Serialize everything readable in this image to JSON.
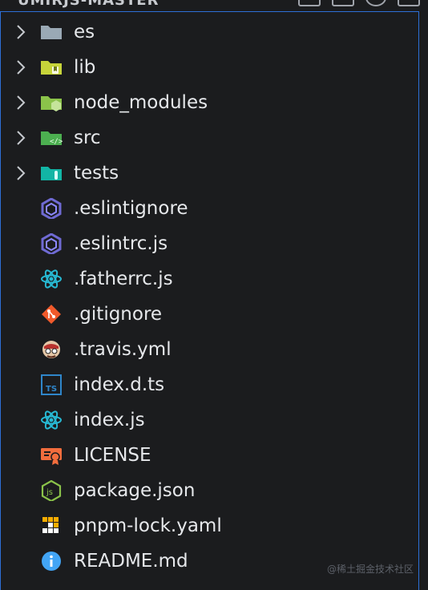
{
  "header": {
    "title": "UMIRJS-MASTER"
  },
  "tree": {
    "items": [
      {
        "label": "es",
        "type": "folder",
        "icon": "folder-icon",
        "color": "#9aa9b5"
      },
      {
        "label": "lib",
        "type": "folder",
        "icon": "folder-lib-icon",
        "color": "#c7d43a"
      },
      {
        "label": "node_modules",
        "type": "folder",
        "icon": "folder-node-icon",
        "color": "#8bc34a"
      },
      {
        "label": "src",
        "type": "folder",
        "icon": "folder-src-icon",
        "color": "#4caf50"
      },
      {
        "label": "tests",
        "type": "folder",
        "icon": "folder-test-icon",
        "color": "#12b5a5"
      },
      {
        "label": ".eslintignore",
        "type": "file",
        "icon": "eslint-icon",
        "color": "#6f6ad3"
      },
      {
        "label": ".eslintrc.js",
        "type": "file",
        "icon": "eslint-icon",
        "color": "#6f6ad3"
      },
      {
        "label": ".fatherrc.js",
        "type": "file",
        "icon": "react-icon",
        "color": "#27b9d3"
      },
      {
        "label": ".gitignore",
        "type": "file",
        "icon": "git-icon",
        "color": "#f15a2b"
      },
      {
        "label": ".travis.yml",
        "type": "file",
        "icon": "travis-icon",
        "color": "#e5c7a7"
      },
      {
        "label": "index.d.ts",
        "type": "file",
        "icon": "typescript-icon",
        "color": "#2f86ca"
      },
      {
        "label": "index.js",
        "type": "file",
        "icon": "react-icon",
        "color": "#27b9d3"
      },
      {
        "label": "LICENSE",
        "type": "file",
        "icon": "license-icon",
        "color": "#f26d3d"
      },
      {
        "label": "package.json",
        "type": "file",
        "icon": "nodejs-icon",
        "color": "#8bc34a"
      },
      {
        "label": "pnpm-lock.yaml",
        "type": "file",
        "icon": "pnpm-icon",
        "color": "#f9ad00"
      },
      {
        "label": "README.md",
        "type": "file",
        "icon": "info-icon",
        "color": "#42a5f5"
      }
    ]
  },
  "watermark": "@稀土掘金技术社区"
}
